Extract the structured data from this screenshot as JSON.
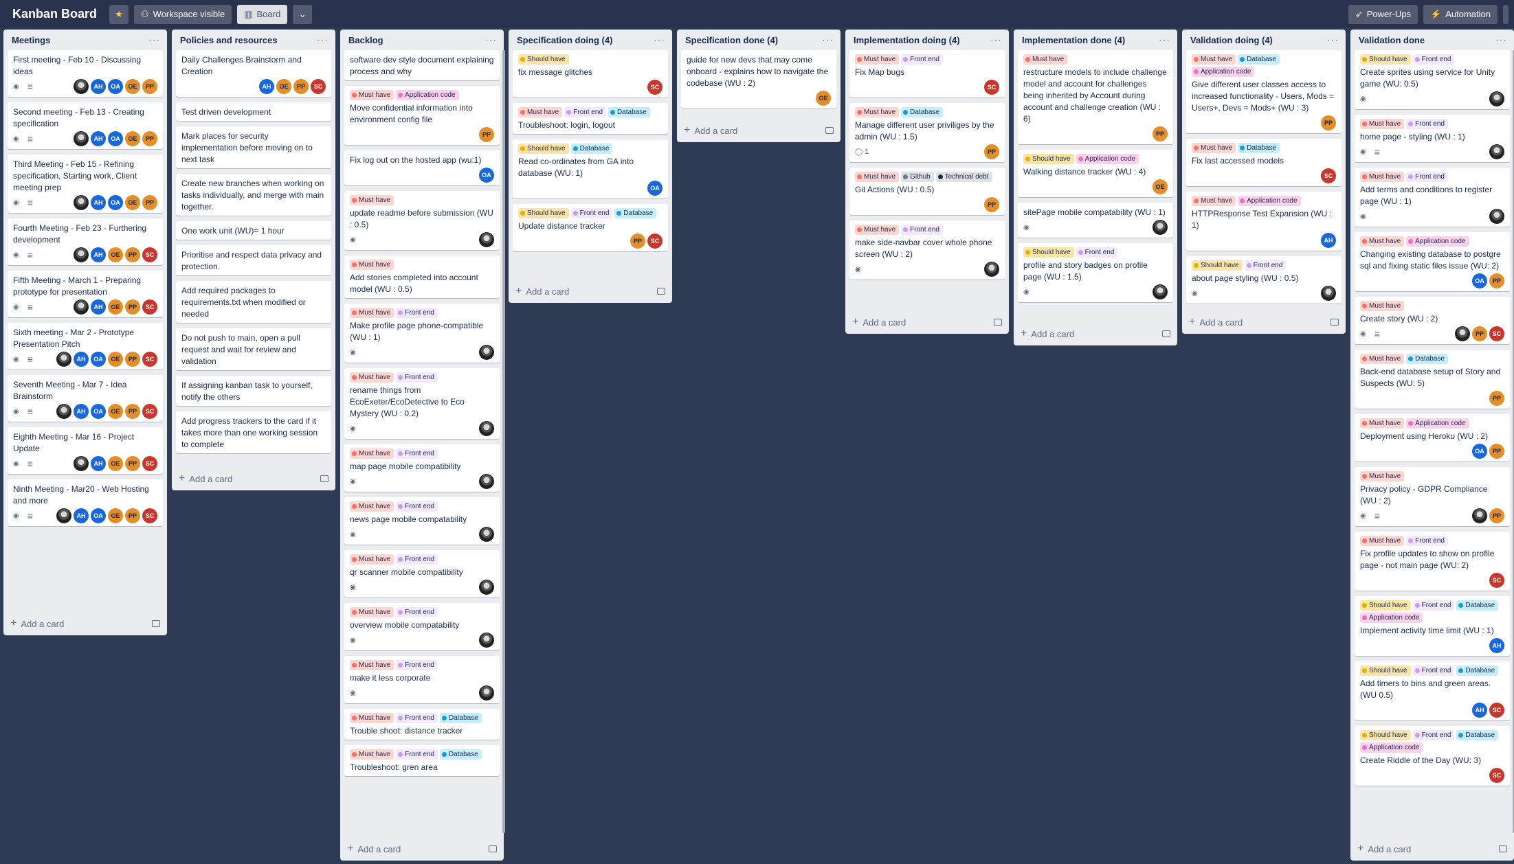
{
  "topbar": {
    "title": "Kanban Board",
    "visibility": "Workspace visible",
    "view": "Board",
    "power_ups": "Power-Ups",
    "automation": "Automation"
  },
  "icons": {
    "star": "star-icon",
    "eye": "eye-icon",
    "description": "description-icon",
    "comment": "comment-icon",
    "plus": "plus-icon",
    "template": "template-icon"
  },
  "colors": {
    "board_bg": "#2f3a55",
    "list_bg": "#ebecf0",
    "must_have": "#f87168",
    "should_have": "#e2b203",
    "front_end": "#c69ff4",
    "database": "#1d9bd1",
    "application_code": "#e774bb"
  },
  "add_card_label": "Add a card",
  "lists": [
    {
      "title": "Meetings",
      "cards": [
        {
          "title": "First meeting - Feb 10 - Discussing ideas",
          "eye": true,
          "desc": true,
          "members": [
            "IMG",
            "AH",
            "OA",
            "OE",
            "PP"
          ]
        },
        {
          "title": "Second meeting - Feb 13 - Creating specification",
          "eye": true,
          "desc": true,
          "members": [
            "IMG",
            "AH",
            "OA",
            "OE",
            "PP"
          ]
        },
        {
          "title": "Third Meeting - Feb 15 - Refining specification, Starting work, Client meeting prep",
          "eye": true,
          "desc": true,
          "members": [
            "IMG",
            "AH",
            "OA",
            "OE",
            "PP"
          ]
        },
        {
          "title": "Fourth Meeting - Feb 23 - Furthering development",
          "eye": true,
          "desc": true,
          "members": [
            "IMG",
            "AH",
            "OE",
            "PP",
            "SC"
          ]
        },
        {
          "title": "Fifth Meeting - March 1 - Preparing prototype for presentation",
          "eye": true,
          "desc": true,
          "members": [
            "IMG",
            "AH",
            "OE",
            "PP",
            "SC"
          ]
        },
        {
          "title": "Sixth meeting - Mar 2 - Prototype Presentation Pitch",
          "eye": true,
          "desc": true,
          "members": [
            "IMG",
            "AH",
            "OA",
            "OE",
            "PP",
            "SC"
          ]
        },
        {
          "title": "Seventh Meeting - Mar 7 - Idea Brainstorm",
          "eye": true,
          "desc": true,
          "members": [
            "IMG",
            "AH",
            "OA",
            "OE",
            "PP",
            "SC"
          ]
        },
        {
          "title": "Eighth Meeting - Mar 16 - Project Update",
          "eye": true,
          "desc": true,
          "members": [
            "IMG",
            "AH",
            "OE",
            "PP",
            "SC"
          ]
        },
        {
          "title": "Ninth Meeting - Mar20 - Web Hosting and more",
          "eye": true,
          "desc": true,
          "members": [
            "IMG",
            "AH",
            "OA",
            "OE",
            "PP",
            "SC"
          ]
        }
      ]
    },
    {
      "title": "Policies and resources",
      "cards": [
        {
          "title": "Daily Challenges Brainstorm and Creation",
          "members": [
            "AH",
            "OE",
            "PP",
            "SC"
          ]
        },
        {
          "title": "Test driven development"
        },
        {
          "title": "Mark places for security implementation before moving on to next task"
        },
        {
          "title": "Create new branches when working on tasks individually, and merge with main together."
        },
        {
          "title": "One work unit (WU)= 1 hour"
        },
        {
          "title": "Prioritise and respect data privacy and protection."
        },
        {
          "title": "Add required packages to requirements.txt when modified or needed"
        },
        {
          "title": "Do not push to main, open a pull request and wait for review and validation"
        },
        {
          "title": "If assigning kanban task to yourself, notify the others"
        },
        {
          "title": "Add progress trackers to the card if it takes more than one working session to complete"
        }
      ]
    },
    {
      "title": "Backlog",
      "cards": [
        {
          "title": "software dev style document explaining process and why"
        },
        {
          "labels": [
            "Must have",
            "Application code"
          ],
          "title": "Move confidential information into environment config file",
          "members": [
            "PP"
          ]
        },
        {
          "title": "Fix log out on the hosted app (wu:1)",
          "members": [
            "OA"
          ]
        },
        {
          "labels": [
            "Must have"
          ],
          "title": "update readme before submission (WU : 0.5)",
          "eye": true,
          "members": [
            "IMG"
          ]
        },
        {
          "labels": [
            "Must have"
          ],
          "title": "Add stories completed into account model (WU : 0.5)"
        },
        {
          "labels": [
            "Must have",
            "Front end"
          ],
          "title": "Make profile page phone-compatible (WU : 1)",
          "eye": true,
          "members": [
            "IMG"
          ]
        },
        {
          "labels": [
            "Must have",
            "Front end"
          ],
          "title": "rename things from EcoExeter/EcoDetective to Eco Mystery (WU : 0.2)",
          "eye": true,
          "members": [
            "IMG"
          ]
        },
        {
          "labels": [
            "Must have",
            "Front end"
          ],
          "title": "map page mobile compatibility",
          "eye": true,
          "members": [
            "IMG"
          ]
        },
        {
          "labels": [
            "Must have",
            "Front end"
          ],
          "title": "news page mobile compatability",
          "eye": true,
          "members": [
            "IMG"
          ]
        },
        {
          "labels": [
            "Must have",
            "Front end"
          ],
          "title": "qr scanner mobile compatibility",
          "eye": true,
          "members": [
            "IMG"
          ]
        },
        {
          "labels": [
            "Must have",
            "Front end"
          ],
          "title": "overview mobile compatability",
          "eye": true,
          "members": [
            "IMG"
          ]
        },
        {
          "labels": [
            "Must have",
            "Front end"
          ],
          "title": "make it less corporate",
          "eye": true,
          "members": [
            "IMG"
          ]
        },
        {
          "labels": [
            "Must have",
            "Front end",
            "Database"
          ],
          "title": "Trouble shoot: distance tracker"
        },
        {
          "labels": [
            "Must have",
            "Front end",
            "Database"
          ],
          "title": "Troubleshoot: gren area"
        }
      ]
    },
    {
      "title": "Specification doing (4)",
      "cards": [
        {
          "labels": [
            "Should have"
          ],
          "title": "fix message glitches",
          "members": [
            "SC"
          ]
        },
        {
          "labels": [
            "Must have",
            "Front end",
            "Database"
          ],
          "title": "Troubleshoot: login, logout"
        },
        {
          "labels": [
            "Should have",
            "Database"
          ],
          "title": "Read co-ordinates from GA into database (WU: 1)",
          "members": [
            "OA"
          ]
        },
        {
          "labels": [
            "Should have",
            "Front end",
            "Database"
          ],
          "title": "Update distance tracker",
          "members": [
            "PP",
            "SC"
          ]
        }
      ]
    },
    {
      "title": "Specification done (4)",
      "cards": [
        {
          "title": "guide for new devs that may come onboard - explains how to navigate the codebase (WU : 2)",
          "members": [
            "OE"
          ]
        }
      ]
    },
    {
      "title": "Implementation doing (4)",
      "cards": [
        {
          "labels": [
            "Must have",
            "Front end"
          ],
          "title": "Fix Map bugs",
          "members": [
            "SC"
          ]
        },
        {
          "labels": [
            "Must have",
            "Database"
          ],
          "title": "Manage different user priviliges by the admin (WU : 1.5)",
          "comments": "1",
          "members": [
            "PP"
          ]
        },
        {
          "labels": [
            "Must have",
            "Github",
            "Technical debt"
          ],
          "title": "Git Actions (WU : 0.5)",
          "members": [
            "PP"
          ]
        },
        {
          "labels": [
            "Must have",
            "Front end"
          ],
          "title": "make side-navbar cover whole phone screen (WU : 2)",
          "eye": true,
          "members": [
            "IMG"
          ]
        }
      ]
    },
    {
      "title": "Implementation done (4)",
      "cards": [
        {
          "labels": [
            "Must have"
          ],
          "title": "restructure models to include challenge model and account for challenges being inherited by Account during account and challenge creation (WU : 6)",
          "members": [
            "PP"
          ]
        },
        {
          "labels": [
            "Should have",
            "Application code"
          ],
          "title": "Walking distance tracker (WU : 4)",
          "members": [
            "OE"
          ]
        },
        {
          "title": "sitePage mobile compatability (WU : 1)",
          "eye": true,
          "members": [
            "IMG"
          ]
        },
        {
          "labels": [
            "Should have",
            "Front end"
          ],
          "title": "profile and story badges on profile page (WU : 1.5)",
          "eye": true,
          "members": [
            "IMG"
          ]
        }
      ]
    },
    {
      "title": "Validation doing (4)",
      "cards": [
        {
          "labels": [
            "Must have",
            "Database",
            "Application code"
          ],
          "title": "Give different user classes access to increased functionality - Users, Mods = Users+, Devs = Mods+ (WU : 3)",
          "members": [
            "PP"
          ]
        },
        {
          "labels": [
            "Must have",
            "Database"
          ],
          "title": "Fix last accessed models",
          "members": [
            "SC"
          ]
        },
        {
          "labels": [
            "Must have",
            "Application code"
          ],
          "title": "HTTPResponse Test Expansion (WU : 1)",
          "members": [
            "AH"
          ]
        },
        {
          "labels": [
            "Should have",
            "Front end"
          ],
          "title": "about page styling (WU : 0.5)",
          "eye": true,
          "members": [
            "IMG"
          ]
        }
      ]
    },
    {
      "title": "Validation done",
      "cards": [
        {
          "labels": [
            "Should have",
            "Front end"
          ],
          "title": "Create sprites using service for Unity game (WU: 0.5)",
          "eye": true,
          "members": [
            "IMG"
          ]
        },
        {
          "labels": [
            "Must have",
            "Front end"
          ],
          "title": "home page - styling (WU : 1)",
          "eye": true,
          "desc": true,
          "members": [
            "IMG"
          ]
        },
        {
          "labels": [
            "Must have",
            "Front end"
          ],
          "title": "Add terms and conditions to register page (WU : 1)",
          "eye": true,
          "members": [
            "IMG"
          ]
        },
        {
          "labels": [
            "Must have",
            "Application code"
          ],
          "title": "Changing existing database to postgre sql and fixing static files issue (WU: 2)",
          "members": [
            "OA",
            "PP"
          ]
        },
        {
          "labels": [
            "Must have"
          ],
          "title": "Create story (WU : 2)",
          "eye": true,
          "desc": true,
          "members": [
            "IMG",
            "PP",
            "SC"
          ]
        },
        {
          "labels": [
            "Must have",
            "Database"
          ],
          "title": "Back-end database setup of Story and Suspects (WU: 5)",
          "members": [
            "PP"
          ]
        },
        {
          "labels": [
            "Must have",
            "Application code"
          ],
          "title": "Deployment using Heroku (WU : 2)",
          "members": [
            "OA",
            "PP"
          ]
        },
        {
          "labels": [
            "Must have"
          ],
          "title": "Privacy policy - GDPR Compliance (WU : 2)",
          "eye": true,
          "desc": true,
          "members": [
            "IMG",
            "PP"
          ]
        },
        {
          "labels": [
            "Must have",
            "Front end"
          ],
          "title": "Fix profile updates to show on profile page - not main page (WU: 2)",
          "members": [
            "SC"
          ]
        },
        {
          "labels": [
            "Should have",
            "Front end",
            "Database",
            "Application code"
          ],
          "title": "Implement activity time limit (WU : 1)",
          "members": [
            "AH"
          ]
        },
        {
          "labels": [
            "Should have",
            "Front end",
            "Database"
          ],
          "title": "Add timers to bins and green areas. (WU 0.5)",
          "members": [
            "AH",
            "SC"
          ]
        },
        {
          "labels": [
            "Should have",
            "Front end",
            "Database",
            "Application code"
          ],
          "title": "Create Riddle of the Day (WU: 3)",
          "members": [
            "SC"
          ]
        }
      ]
    }
  ]
}
